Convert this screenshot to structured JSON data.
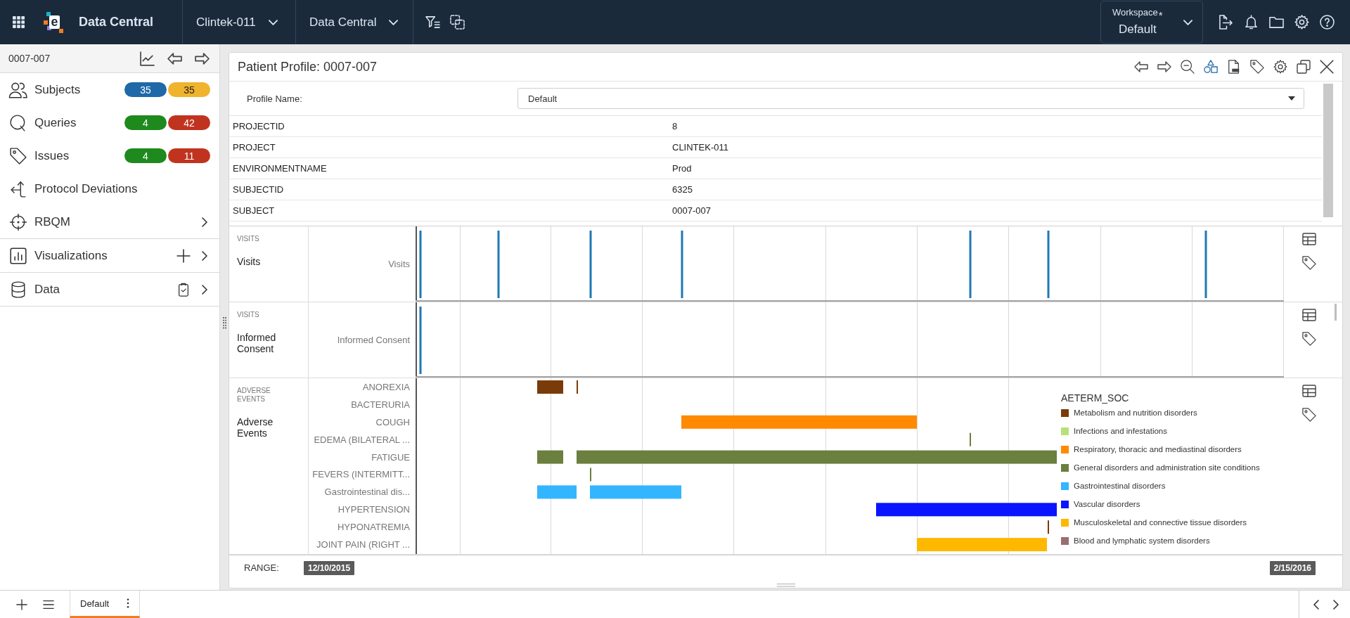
{
  "app_bar": {
    "logo_mark": "e",
    "app_name": "Data Central",
    "selectors": [
      {
        "value": "Clintek-011"
      },
      {
        "value": "Data Central"
      }
    ],
    "workspace": {
      "label": "Workspace",
      "marker": "*",
      "value": "Default"
    }
  },
  "sidebar": {
    "subject_id": "0007-007",
    "groups": [
      {
        "items": [
          {
            "kind": "counts",
            "label": "Subjects",
            "badges": [
              {
                "text": "35",
                "color": "#1f69a8"
              },
              {
                "text": "35",
                "color": "#f0b32d"
              }
            ]
          },
          {
            "kind": "counts",
            "label": "Queries",
            "badges": [
              {
                "text": "4",
                "color": "#1e8a1e"
              },
              {
                "text": "42",
                "color": "#c0341f"
              }
            ]
          },
          {
            "kind": "counts",
            "label": "Issues",
            "badges": [
              {
                "text": "4",
                "color": "#1e8a1e"
              },
              {
                "text": "11",
                "color": "#c0341f"
              }
            ]
          },
          {
            "kind": "plain",
            "label": "Protocol Deviations"
          },
          {
            "kind": "submenu",
            "label": "RBQM"
          }
        ]
      },
      {
        "items": [
          {
            "kind": "submenu",
            "label": "Visualizations"
          }
        ]
      },
      {
        "items": [
          {
            "kind": "submenu",
            "label": "Data"
          }
        ]
      }
    ]
  },
  "panel": {
    "title": "Patient Profile: 0007-007",
    "profile_name": {
      "label": "Profile Name:",
      "value": "Default"
    },
    "fields": [
      {
        "name": "PROJECTID",
        "value": "8"
      },
      {
        "name": "PROJECT",
        "value": "CLINTEK-011"
      },
      {
        "name": "ENVIRONMENTNAME",
        "value": "Prod"
      },
      {
        "name": "SUBJECTID",
        "value": "6325"
      },
      {
        "name": "SUBJECT",
        "value": "0007-007"
      }
    ],
    "tracks": [
      {
        "kind": "events",
        "group": "VISITS",
        "title": "Visits",
        "rows": [
          "Visits"
        ]
      },
      {
        "kind": "events",
        "group": "VISITS",
        "title": "Informed Consent",
        "rows": [
          "Informed Consent"
        ]
      },
      {
        "kind": "intervals",
        "group": "ADVERSE EVENTS",
        "title": "Adverse Events",
        "rows": [
          "ANOREXIA",
          "BACTERURIA",
          "COUGH",
          "EDEMA (BILATERAL ...",
          "FATIGUE",
          "FEVERS (INTERMITT...",
          "Gastrointestinal dis...",
          "HYPERTENSION",
          "HYPONATREMIA",
          "JOINT PAIN (RIGHT ..."
        ],
        "legend": {
          "title": "AETERM_SOC",
          "items": [
            {
              "label": "Metabolism and nutrition disorders",
              "color": "#7a3b0a"
            },
            {
              "label": "Infections and infestations",
              "color": "#b8e07a"
            },
            {
              "label": "Respiratory, thoracic and mediastinal disorders",
              "color": "#ff8a00"
            },
            {
              "label": "General disorders and administration site conditions",
              "color": "#6b7f3e"
            },
            {
              "label": "Gastrointestinal disorders",
              "color": "#33b5ff"
            },
            {
              "label": "Vascular disorders",
              "color": "#0a14ff"
            },
            {
              "label": "Musculoskeletal and connective tissue disorders",
              "color": "#ffb800"
            },
            {
              "label": "Blood and lymphatic system disorders",
              "color": "#9b6e6e"
            }
          ]
        }
      }
    ],
    "range": {
      "label": "RANGE:",
      "start": "12/10/2015",
      "end": "2/15/2016"
    }
  },
  "bottom_bar": {
    "tabs": [
      {
        "label": "Default",
        "selected": true
      }
    ]
  }
}
